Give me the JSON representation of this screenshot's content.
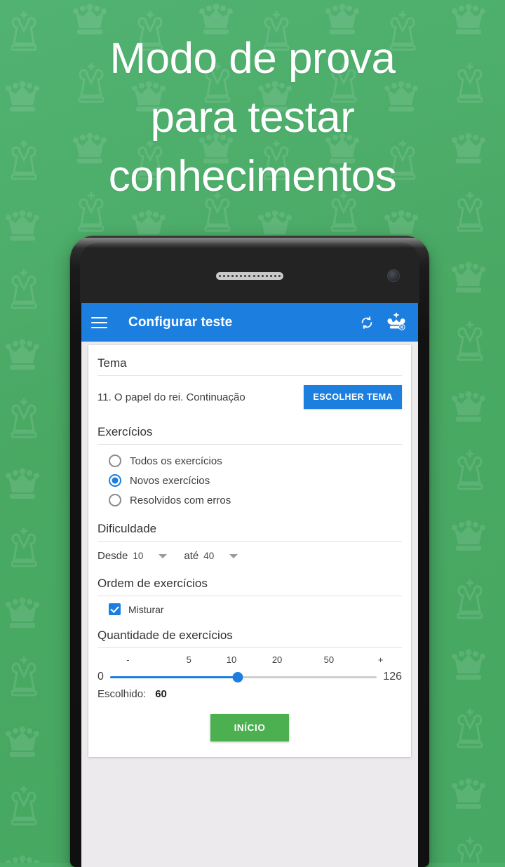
{
  "promo": {
    "headline": "Modo de prova\npara testar\nconhecimentos",
    "bg_color": "#4caf6a",
    "headline_color": "#ffffff"
  },
  "appbar": {
    "title": "Configurar teste",
    "menu_icon": "hamburger-menu-icon",
    "sync_icon": "sync-refresh-icon",
    "logo_icon": "chess-king-logo-icon",
    "bg_color": "#1c7fe0"
  },
  "form": {
    "theme": {
      "section_label": "Tema",
      "value": "11. O papel do rei. Continuação",
      "button_label": "ESCOLHER TEMA",
      "button_color": "#1c7fe0"
    },
    "exercises": {
      "section_label": "Exercícios",
      "options": [
        {
          "label": "Todos os exercícios",
          "selected": false
        },
        {
          "label": "Novos exercícios",
          "selected": true
        },
        {
          "label": "Resolvidos com erros",
          "selected": false
        }
      ]
    },
    "difficulty": {
      "section_label": "Dificuldade",
      "from_label": "Desde",
      "from_value": "10",
      "to_label": "até",
      "to_value": "40"
    },
    "order": {
      "section_label": "Ordem de exercícios",
      "shuffle_label": "Misturar",
      "shuffle_checked": true
    },
    "quantity": {
      "section_label": "Quantidade de exercícios",
      "min": "0",
      "max": "126",
      "ticks": [
        "-",
        "5",
        "10",
        "20",
        "50",
        "+"
      ],
      "tick_positions": [
        10,
        30,
        44,
        59,
        76,
        93
      ],
      "thumb_percent": 48,
      "chosen_label": "Escolhido:",
      "chosen_value": "60",
      "accent_color": "#1c7fe0"
    },
    "start_button": {
      "label": "INÍCIO",
      "color": "#4caf50"
    }
  }
}
